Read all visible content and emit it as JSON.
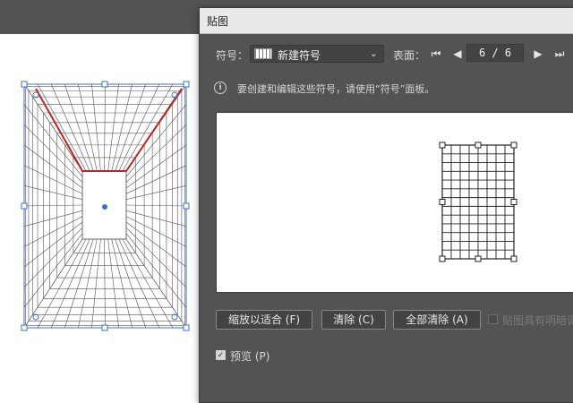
{
  "dialog": {
    "title": "贴图",
    "symbol_label": "符号：",
    "symbol_value": "新建符号",
    "surface_label": "表面：",
    "page_indicator": "6 / 6",
    "info_text": "要创建和编辑这些符号，请使用“符号”面板。",
    "buttons": {
      "zoom_fit": "缩放以适合 (F)",
      "clear": "清除 (C)",
      "clear_all": "全部清除 (A)"
    },
    "shaded_artwork_label": "贴图具有明暗调",
    "preview_label": "预览 (P)",
    "preview_checked": true,
    "shaded_checked": false
  },
  "icons": {
    "dropdown": "chevron-down-icon",
    "first": "first-page-icon",
    "prev": "prev-page-icon",
    "next": "next-page-icon",
    "last": "last-page-icon",
    "info": "info-icon",
    "check": "checkmark-icon"
  },
  "colors": {
    "panel_bg": "#535353",
    "selection_blue": "#3d6fd0",
    "highlight_red": "#cc2020"
  }
}
